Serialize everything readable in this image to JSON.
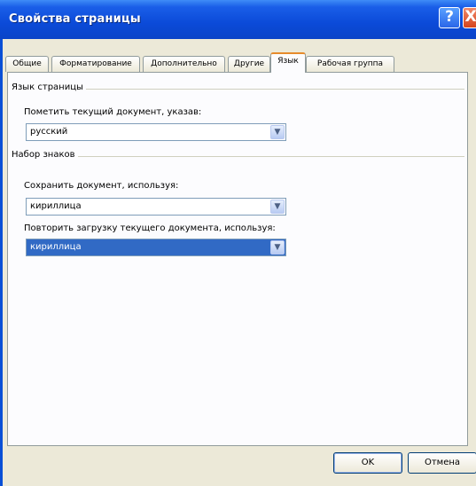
{
  "window": {
    "title": "Свойства страницы",
    "help_label": "?",
    "close_label": "X"
  },
  "tabs": [
    {
      "label": "Общие"
    },
    {
      "label": "Форматирование"
    },
    {
      "label": "Дополнительно"
    },
    {
      "label": "Другие"
    },
    {
      "label": "Язык",
      "active": true
    },
    {
      "label": "Рабочая группа"
    }
  ],
  "page_language": {
    "group_title": "Язык страницы",
    "field_label": "Пометить текущий документ, указав:",
    "value": "русский"
  },
  "charset": {
    "group_title": "Набор знаков",
    "save_label": "Сохранить документ, используя:",
    "save_value": "кириллица",
    "reload_label": "Повторить загрузку текущего документа, используя:",
    "reload_value": "кириллица"
  },
  "buttons": {
    "ok": "OK",
    "cancel": "Отмена"
  },
  "icons": {
    "dropdown": "chevron-down-icon"
  },
  "colors": {
    "titlebar": "#0a4fd6",
    "selection": "#316ac5",
    "dialog_bg": "#ece9d8",
    "tab_accent": "#e68b2c"
  }
}
